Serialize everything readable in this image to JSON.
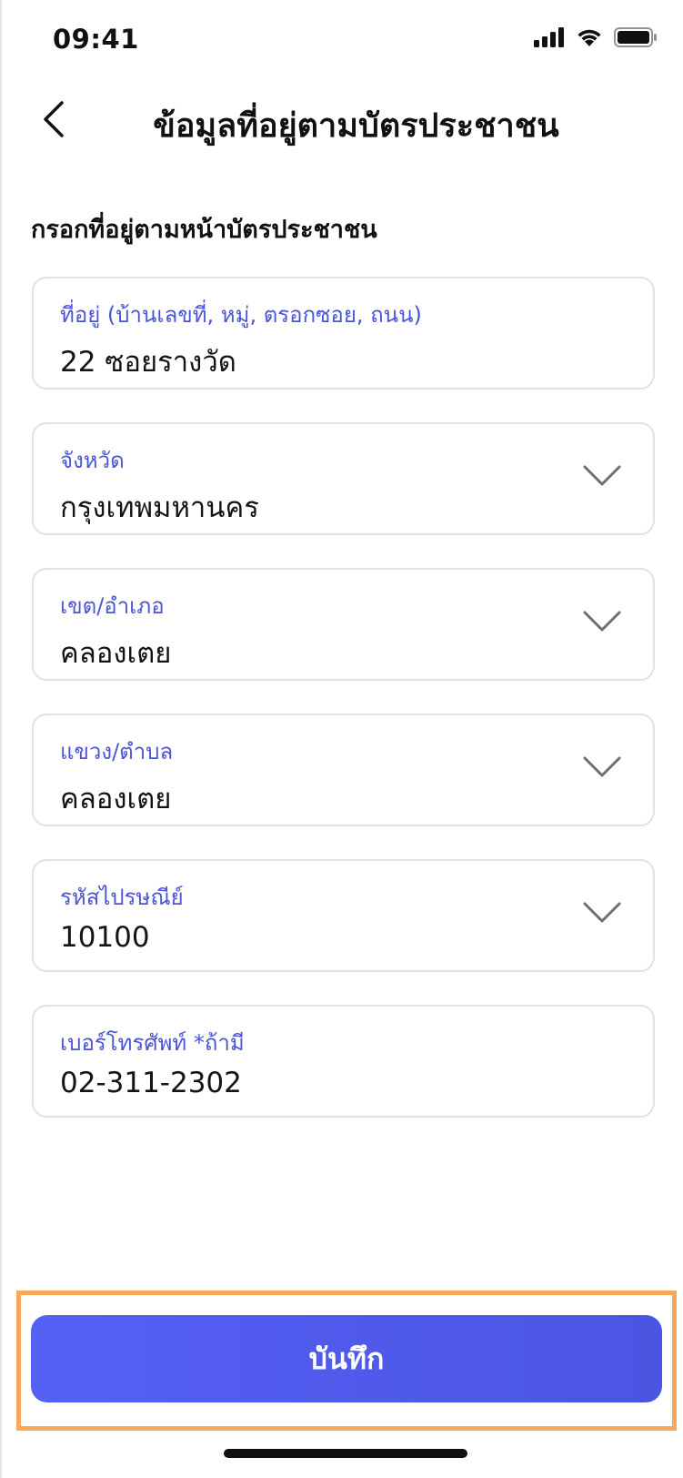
{
  "status_bar": {
    "time": "09:41",
    "icons": [
      "cellular-signal-icon",
      "wifi-icon",
      "battery-icon"
    ]
  },
  "header": {
    "title": "ข้อมูลที่อยู่ตามบัตรประชาชน",
    "back_icon": "chevron-left-icon"
  },
  "form": {
    "heading": "กรอกที่อยู่ตามหน้าบัตรประชาชน",
    "fields": [
      {
        "label": "ที่อยู่ (บ้านเลขที่, หมู่, ตรอกซอย, ถนน)",
        "value": "22 ซอยรางวัด",
        "type": "text"
      },
      {
        "label": "จังหวัด",
        "value": "กรุงเทพมหานคร",
        "type": "select"
      },
      {
        "label": "เขต/อำเภอ",
        "value": "คลองเตย",
        "type": "select"
      },
      {
        "label": "แขวง/ตำบล",
        "value": "คลองเตย",
        "type": "select"
      },
      {
        "label": "รหัสไปรษณีย์",
        "value": "10100",
        "type": "select"
      },
      {
        "label": "เบอร์โทรศัพท์ *ถ้ามี",
        "value": "02-311-2302",
        "type": "text"
      }
    ]
  },
  "footer": {
    "save_label": "บันทึก"
  },
  "colors": {
    "accent": "#4a55d8",
    "button": "#5059EE",
    "highlight_border": "#f9a85a"
  }
}
